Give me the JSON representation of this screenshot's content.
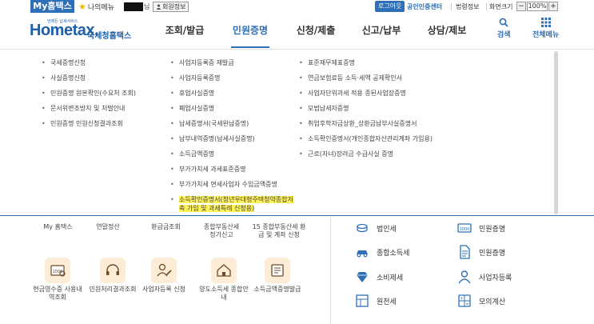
{
  "topbar": {
    "my_hometax": "My홈택스",
    "my_menu": "나의메뉴",
    "name_suffix": "님",
    "member_info": "회원정보",
    "logout": "로그아웃",
    "certificate_center": "공인인증센터",
    "law_info": "법령정보",
    "screen_size_label": "화면크기",
    "zoom_minus": "−",
    "zoom_value": "100%",
    "zoom_plus": "+"
  },
  "header": {
    "logo_text": "Hometax.",
    "logo_tagline": "언제든 납세서비스",
    "logo_sub": "국세청홈택스",
    "nav": [
      {
        "label": "조회/발급"
      },
      {
        "label": "민원증명"
      },
      {
        "label": "신청/제출"
      },
      {
        "label": "신고/납부"
      },
      {
        "label": "상담/제보"
      }
    ],
    "search_label": "검색",
    "all_menu_label": "전체메뉴"
  },
  "dropdown": {
    "col1": [
      "국세증명신청",
      "사실증명신청",
      "민원증명 원본확인(수요처 조회)",
      "문서위변조방지 및 처벌안내",
      "민원증명 민원신청결과조회"
    ],
    "col2": [
      "사업자등록증 재발급",
      "사업자등록증명",
      "휴업사실증명",
      "폐업사실증명",
      "납세증명서(국세완납증명)",
      "납부내역증명(납세사실증명)",
      "소득금액증명",
      "부가가치세 과세표준증명",
      "부가가치세 면세사업자 수입금액증명",
      "소득확인증명서(청년우대형주택청약종합저축 가입 및 과세특례 신청용)"
    ],
    "col3": [
      "표준재무제표증명",
      "연금보험료등 소득·세액 공제확인서",
      "사업자단위과세 적용 종된사업장증명",
      "모범납세자증명",
      "취업후학자금상환_상환금납부사실증명서",
      "소득확인증명서(개인종합자산관리계좌 가입용)",
      "근로(자녀)장려금 수급사실 증명"
    ]
  },
  "behind": {
    "row1": [
      "My 홈택스",
      "연말정산",
      "환급금조회",
      "종합부동산세 정기신고",
      "15 종합부동산세 환급 및 계좌 신청"
    ],
    "services": [
      {
        "label": "현금영수증 사용내역조회",
        "icon": "receipt-icon"
      },
      {
        "label": "민원처리결과조회",
        "icon": "headset-icon"
      },
      {
        "label": "사업자등록 신청",
        "icon": "user-edit-icon"
      },
      {
        "label": "양도소득세 종합안내",
        "icon": "house-icon"
      },
      {
        "label": "소득금액증명발급",
        "icon": "certificate-icon"
      }
    ],
    "right_list": [
      {
        "label": "법인세",
        "icon": "coins-icon"
      },
      {
        "label": "민원증명",
        "icon": "bill-icon"
      },
      {
        "label": "종합소득세",
        "icon": "car-icon"
      },
      {
        "label": "민원증명",
        "icon": "document-icon"
      },
      {
        "label": "소비제세",
        "icon": "diamond-icon"
      },
      {
        "label": "사업자등록",
        "icon": "person-icon"
      },
      {
        "label": "원천세",
        "icon": "table-icon"
      },
      {
        "label": "모의계산",
        "icon": "calculator-icon"
      }
    ]
  },
  "colors": {
    "brand_blue": "#2f6fb8",
    "highlight": "#fff35a",
    "tile_bg": "#fdecd6"
  }
}
